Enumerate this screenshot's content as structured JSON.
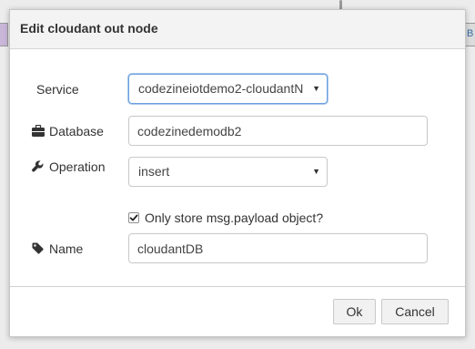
{
  "background": {
    "right_node_text": "B"
  },
  "dialog": {
    "title": "Edit cloudant out node",
    "fields": {
      "service": {
        "label": "Service",
        "value": "codezineiotdemo2-cloudantN"
      },
      "database": {
        "label": "Database",
        "icon": "briefcase-icon",
        "value": "codezinedemodb2"
      },
      "operation": {
        "label": "Operation",
        "icon": "wrench-icon",
        "value": "insert"
      },
      "payload_only": {
        "label": "Only store msg.payload object?",
        "checked": true
      },
      "name": {
        "label": "Name",
        "icon": "tag-icon",
        "value": "cloudantDB"
      }
    },
    "buttons": {
      "ok": "Ok",
      "cancel": "Cancel"
    }
  },
  "colors": {
    "focus_border": "#6aa0df",
    "header_bg": "#f3f3f3"
  }
}
